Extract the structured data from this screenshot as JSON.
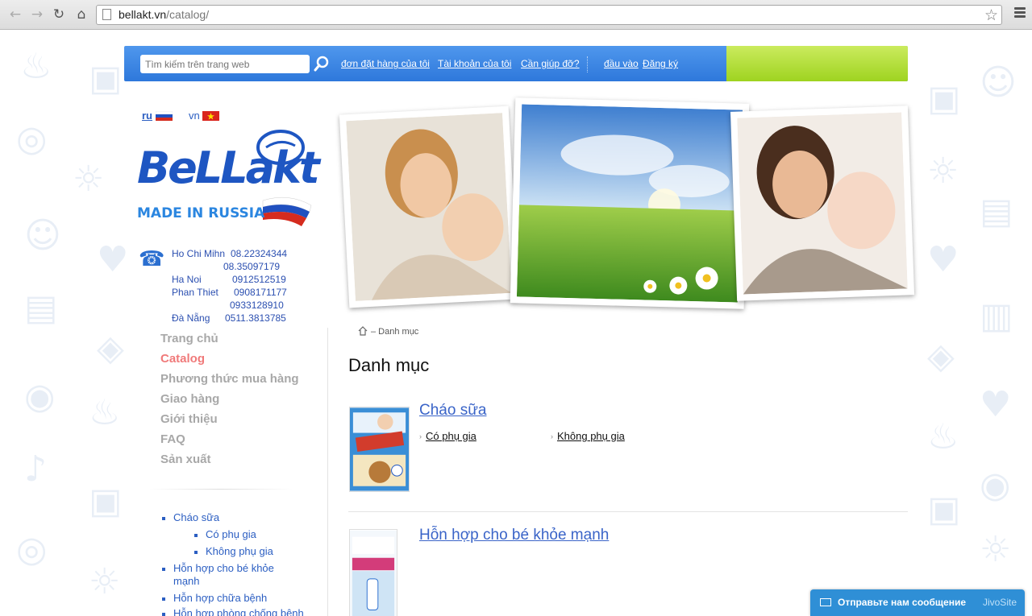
{
  "browser": {
    "url_host": "bellakt.vn",
    "url_path": "/catalog/"
  },
  "topbar": {
    "search_placeholder": "Tìm kiếm trên trang web",
    "links": [
      "đơn đặt hàng của tôi",
      "Tài khoản của tôi",
      "Cần giúp đỡ?",
      "đầu vào",
      "Đăng ký"
    ],
    "bar_color": "#3a84e2",
    "accent_color": "#b5e03a"
  },
  "lang": {
    "ru": "ru",
    "vn": "vn"
  },
  "logo": {
    "name": "BeLLakt",
    "tagline": "MADE IN RUSSIA"
  },
  "contacts": [
    {
      "city": "Ho Chi Mihn",
      "phone": "08.22324344"
    },
    {
      "city": "",
      "phone": "08.35097179"
    },
    {
      "city": "Ha Noi",
      "phone": "0912512519"
    },
    {
      "city": "Phan Thiet",
      "phone": "0908171177"
    },
    {
      "city": "",
      "phone": "0933128910"
    },
    {
      "city": "Đà Nẵng",
      "phone": "0511.3813785"
    }
  ],
  "nav": [
    "Trang chủ",
    "Catalog",
    "Phương thức mua hàng",
    "Giao hàng",
    "Giới thiệu",
    "FAQ",
    "Sản xuất"
  ],
  "nav_active_color": "#f07a7a",
  "tree": [
    {
      "label": "Cháo sữa",
      "level": 1
    },
    {
      "label": "Có phụ gia",
      "level": 2
    },
    {
      "label": "Không phụ gia",
      "level": 2
    },
    {
      "label": "Hỗn hợp cho bé khỏe mạnh",
      "level": 1
    },
    {
      "label": "Hỗn hợp chữa bệnh",
      "level": 1
    },
    {
      "label": "Hỗn hợp phòng chống bệnh",
      "level": 1
    }
  ],
  "breadcrumb": "– Danh mục",
  "page_title": "Danh mục",
  "categories": [
    {
      "title": "Cháo sữa",
      "subs": [
        "Có phụ gia",
        "Không phụ gia"
      ]
    },
    {
      "title": "Hỗn hợp cho bé khỏe mạnh",
      "subs": []
    }
  ],
  "jivo": {
    "text": "Отправьте нам сообщение",
    "brand": "JivoSite"
  }
}
